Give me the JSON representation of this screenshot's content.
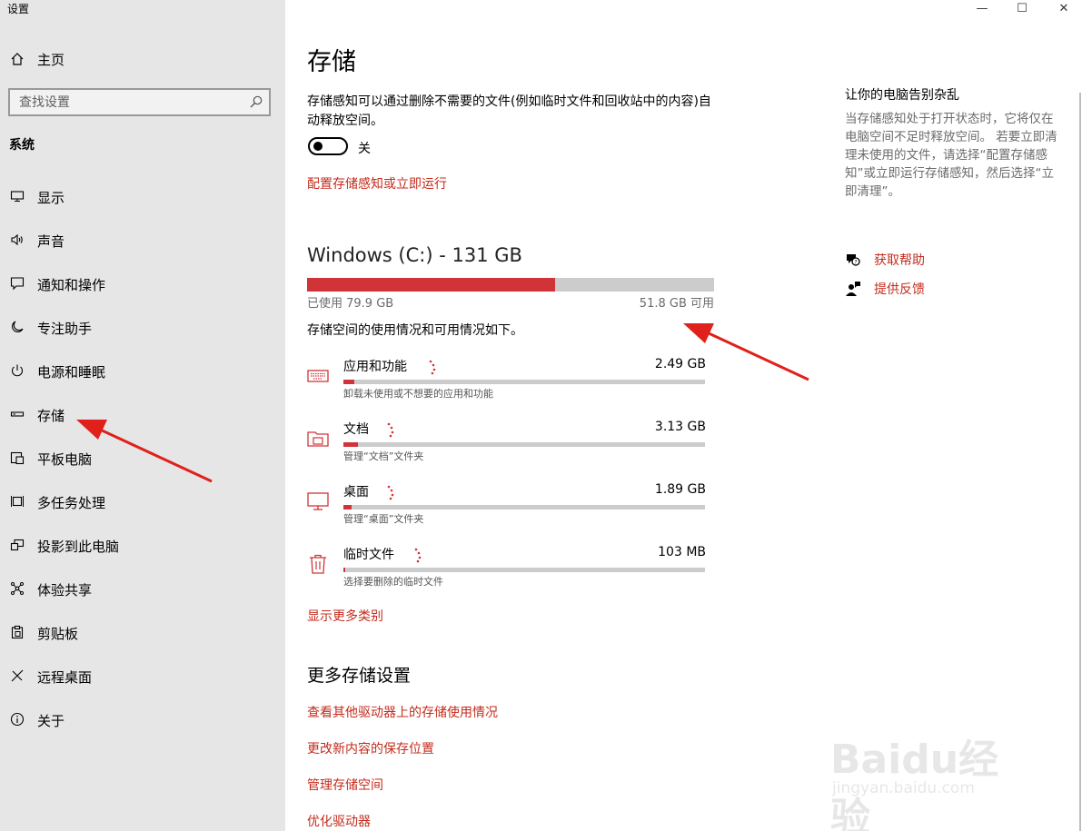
{
  "app": {
    "title": "设置"
  },
  "window_controls": {
    "minimize": "—",
    "maximize": "☐",
    "close": "✕"
  },
  "sidebar": {
    "home": "主页",
    "search_placeholder": "查找设置",
    "section": "系统",
    "items": [
      {
        "label": "显示",
        "icon": "display-icon"
      },
      {
        "label": "声音",
        "icon": "sound-icon"
      },
      {
        "label": "通知和操作",
        "icon": "notification-icon"
      },
      {
        "label": "专注助手",
        "icon": "moon-icon"
      },
      {
        "label": "电源和睡眠",
        "icon": "power-icon"
      },
      {
        "label": "存储",
        "icon": "storage-icon"
      },
      {
        "label": "平板电脑",
        "icon": "tablet-icon"
      },
      {
        "label": "多任务处理",
        "icon": "multitask-icon"
      },
      {
        "label": "投影到此电脑",
        "icon": "project-icon"
      },
      {
        "label": "体验共享",
        "icon": "share-icon"
      },
      {
        "label": "剪贴板",
        "icon": "clipboard-icon"
      },
      {
        "label": "远程桌面",
        "icon": "remote-icon"
      },
      {
        "label": "关于",
        "icon": "info-icon"
      }
    ]
  },
  "main": {
    "title": "存储",
    "sense_desc": "存储感知可以通过删除不需要的文件(例如临时文件和回收站中的内容)自动释放空间。",
    "toggle_state": "关",
    "configure_link": "配置存储感知或立即运行",
    "drive": {
      "title": "Windows (C:) - 131 GB",
      "used_label": "已使用 79.9 GB",
      "free_label": "51.8 GB 可用",
      "used_fraction": 0.61
    },
    "usage_desc": "存储空间的使用情况和可用情况如下。",
    "categories": [
      {
        "name": "应用和功能",
        "size": "2.49 GB",
        "sub": "卸载未使用或不想要的应用和功能",
        "fraction": 0.03,
        "icon": "keyboard-icon"
      },
      {
        "name": "文档",
        "size": "3.13 GB",
        "sub": "管理“文档”文件夹",
        "fraction": 0.04,
        "icon": "folder-icon"
      },
      {
        "name": "桌面",
        "size": "1.89 GB",
        "sub": "管理“桌面”文件夹",
        "fraction": 0.023,
        "icon": "monitor-icon"
      },
      {
        "name": "临时文件",
        "size": "103 MB",
        "sub": "选择要删除的临时文件",
        "fraction": 0.003,
        "icon": "trash-icon"
      }
    ],
    "show_more": "显示更多类别",
    "more_heading": "更多存储设置",
    "more_links": [
      "查看其他驱动器上的存储使用情况",
      "更改新内容的保存位置",
      "管理存储空间",
      "优化驱动器"
    ]
  },
  "right": {
    "title": "让你的电脑告别杂乱",
    "desc": "当存储感知处于打开状态时，它将仅在电脑空间不足时释放空间。 若要立即清理未使用的文件，请选择“配置存储感知”或立即运行存储感知，然后选择“立即清理”。",
    "help_link": "获取帮助",
    "feedback_link": "提供反馈"
  },
  "watermark": {
    "brand": "Baidu经验",
    "url": "jingyan.baidu.com"
  },
  "colors": {
    "accent": "#c42b1c",
    "bar_fill": "#d13438",
    "sidebar_bg": "#e6e6e6"
  }
}
